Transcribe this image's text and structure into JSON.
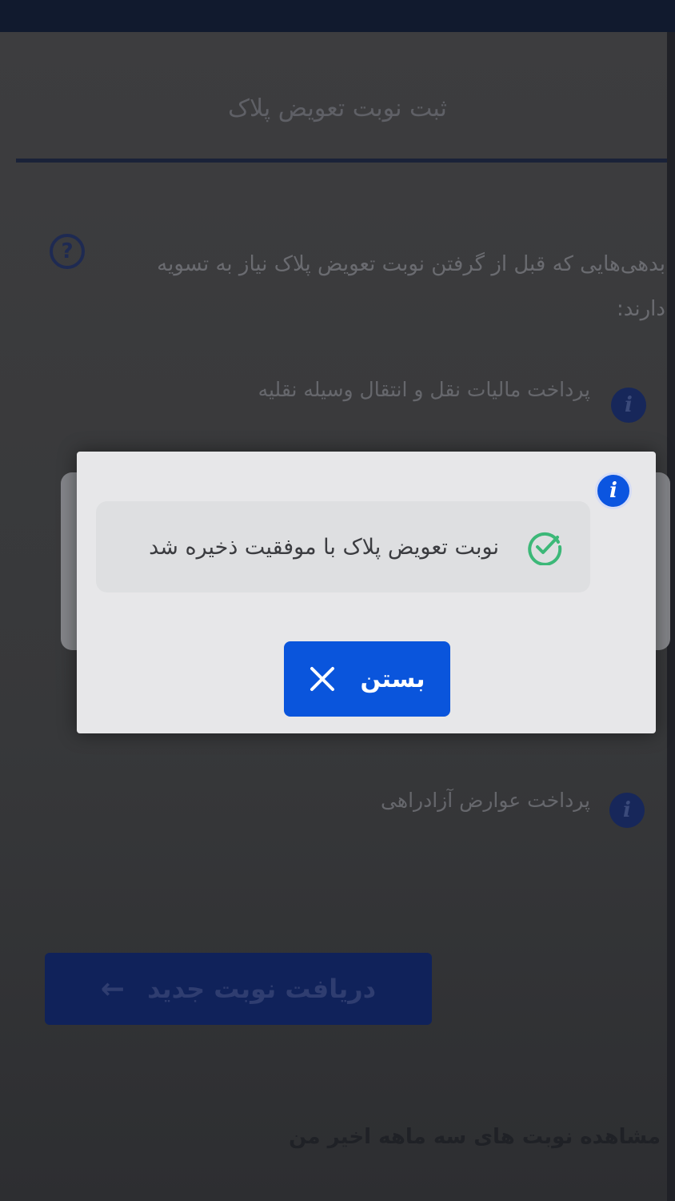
{
  "page": {
    "title": "ثبت نوبت تعویض پلاک",
    "intro": "بدهی‌هایی که قبل از گرفتن نوبت تعویض پلاک نیاز به تسویه دارند:",
    "help_icon": "question-circle-icon",
    "debts": [
      {
        "label": "پرداخت مالیات نقل و انتقال وسیله نقلیه",
        "icon": "info-icon"
      },
      {
        "label": "پرداخت عوارض آزادراهی",
        "icon": "info-icon"
      }
    ],
    "cta_label": "دریافت نوبت جدید",
    "cta_icon": "arrow-left-icon",
    "history_link": "مشاهده نوبت های سه ماهه اخیر من"
  },
  "modal": {
    "icon": "info-icon",
    "message": "نوبت تعویض پلاک با موفقیت ذخیره شد",
    "status_icon": "check-circle-icon",
    "close_label": "بستن",
    "close_icon": "close-icon"
  },
  "colors": {
    "primary": "#0a55dc",
    "success": "#3cb878",
    "overlay": "#3b3b3d"
  }
}
